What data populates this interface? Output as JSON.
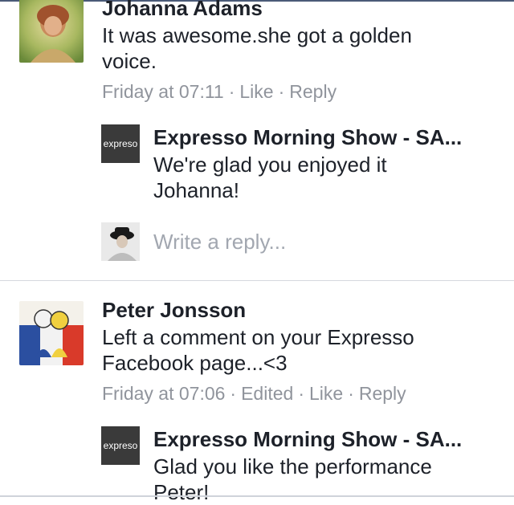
{
  "comments": [
    {
      "author": "Johanna Adams",
      "text_line1": "It was awesome.she got a golden",
      "text_line2": "voice.",
      "time": "Friday at 07:11",
      "like": "Like",
      "reply": "Reply",
      "page_reply": {
        "author": "Expresso Morning Show - SA...",
        "logo_text": "expreso",
        "text_line1": "We're glad you enjoyed it",
        "text_line2": "Johanna!"
      },
      "reply_placeholder": "Write a reply..."
    },
    {
      "author": "Peter Jonsson",
      "text_line1": "Left a comment on your Expresso",
      "text_line2": "Facebook page...<3",
      "time": "Friday at 07:06",
      "edited": "Edited",
      "like": "Like",
      "reply": "Reply",
      "page_reply": {
        "author": "Expresso Morning Show - SA...",
        "logo_text": "expreso",
        "text_line1": "Glad you like the performance",
        "text_line2": "Peter!"
      }
    }
  ],
  "colors": {
    "text": "#1d2129",
    "meta": "#90949c",
    "placeholder": "#a2a7b0",
    "divider": "#d5d8de"
  }
}
